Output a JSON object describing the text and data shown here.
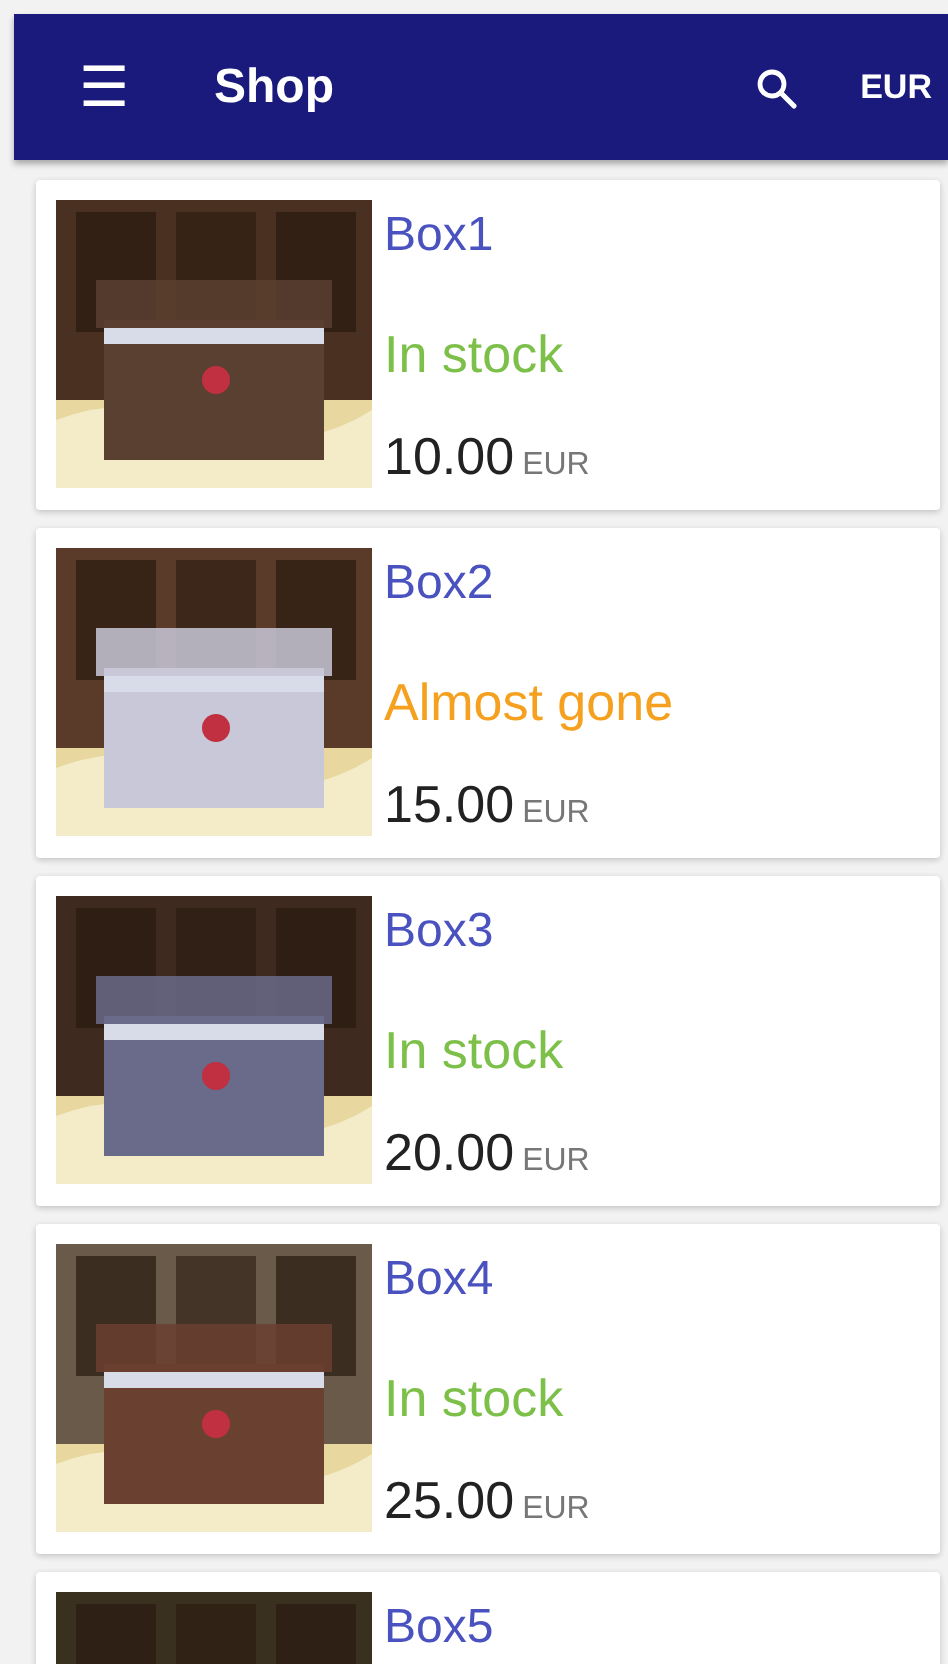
{
  "app_bar": {
    "title": "Shop",
    "menu_icon": "☰",
    "currency": "EUR"
  },
  "products": [
    {
      "name": "Box1",
      "status": "In stock",
      "color": "#7cc04a",
      "price": "10.00",
      "currency": "EUR",
      "kind": "picture"
    },
    {
      "name": "Box2",
      "status": "Almost gone",
      "color": "#f5a01e",
      "price": "15.00",
      "currency": "EUR",
      "kind": "picture"
    },
    {
      "name": "Box3",
      "status": "In stock",
      "color": "#7cc04a",
      "price": "20.00",
      "currency": "EUR",
      "kind": "picture"
    },
    {
      "name": "Box4",
      "status": "In stock",
      "color": "#7cc04a",
      "price": "25.00",
      "currency": "EUR",
      "kind": "picture"
    },
    {
      "name": "Box5",
      "kind": "picture"
    }
  ]
}
